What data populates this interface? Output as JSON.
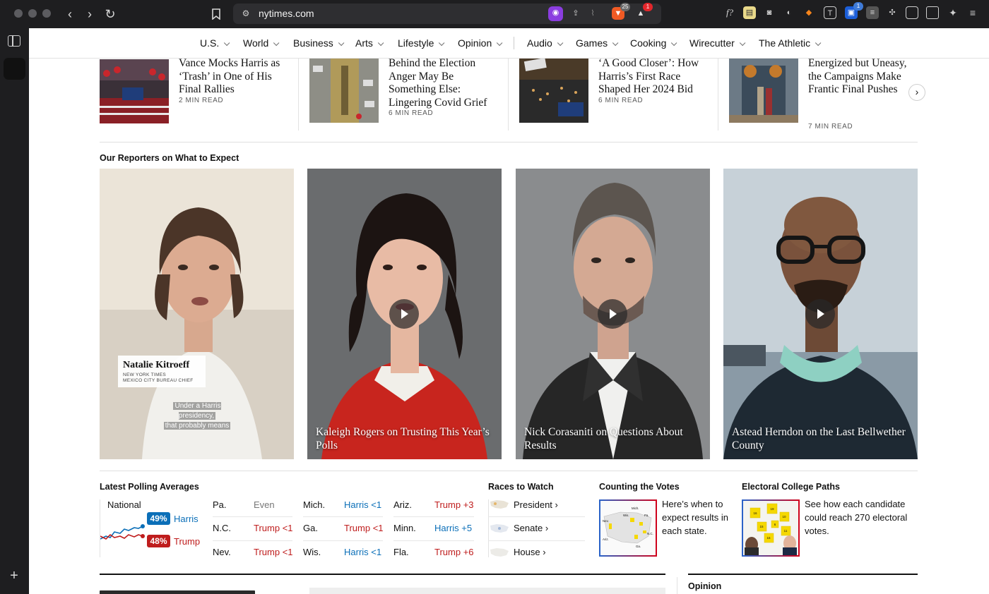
{
  "browser": {
    "url": "nytimes.com",
    "brave_badge": "25",
    "alert_badge": "1",
    "ext_badge": "1"
  },
  "nav": {
    "items": [
      "U.S.",
      "World",
      "Business",
      "Arts",
      "Lifestyle",
      "Opinion",
      "Audio",
      "Games",
      "Cooking",
      "Wirecutter",
      "The Athletic"
    ]
  },
  "stories": [
    {
      "title": "Vance Mocks Harris as ‘Trash’ in One of His Final Rallies",
      "read": "2 MIN READ"
    },
    {
      "title": "Behind the Election Anger May Be Something Else: Lingering Covid Grief",
      "read": "6 MIN READ"
    },
    {
      "title": "‘A Good Closer’: How Harris’s First Race Shaped Her 2024 Bid",
      "read": "6 MIN READ"
    },
    {
      "title": "Energized but Uneasy, the Campaigns Make Frantic Final Pushes",
      "read": "7 MIN READ"
    }
  ],
  "reporters": {
    "heading": "Our Reporters on What to Expect",
    "videos": [
      {
        "caption": "",
        "nametag_name": "Natalie Kitroeff",
        "nametag_org": "NEW YORK TIMES",
        "nametag_role": "MEXICO CITY BUREAU CHIEF",
        "subtitle_1": "Under a Harris presidency,",
        "subtitle_2": "that probably means"
      },
      {
        "caption": "Kaleigh Rogers on Trusting This Year’s Polls"
      },
      {
        "caption": "Nick Corasaniti on Questions About Results"
      },
      {
        "caption": "Astead Herndon on the Last Bellwether County"
      }
    ]
  },
  "polling": {
    "heading": "Latest Polling Averages",
    "national_label": "National",
    "harris_pct": "49%",
    "harris_label": "Harris",
    "trump_pct": "48%",
    "trump_label": "Trump",
    "states": [
      {
        "state": "Pa.",
        "lead": "Even",
        "party": "even"
      },
      {
        "state": "N.C.",
        "lead": "Trump <1",
        "party": "r"
      },
      {
        "state": "Nev.",
        "lead": "Trump <1",
        "party": "r"
      },
      {
        "state": "Mich.",
        "lead": "Harris <1",
        "party": "b"
      },
      {
        "state": "Ga.",
        "lead": "Trump <1",
        "party": "r"
      },
      {
        "state": "Wis.",
        "lead": "Harris <1",
        "party": "b"
      },
      {
        "state": "Ariz.",
        "lead": "Trump +3",
        "party": "r"
      },
      {
        "state": "Minn.",
        "lead": "Harris +5",
        "party": "b"
      },
      {
        "state": "Fla.",
        "lead": "Trump +6",
        "party": "r"
      }
    ],
    "colors": {
      "harris": "#0b6fb8",
      "trump": "#bf1d1d"
    }
  },
  "races": {
    "heading": "Races to Watch",
    "links": [
      "President ›",
      "Senate ›",
      "House ›"
    ]
  },
  "counting": {
    "heading": "Counting the Votes",
    "text": "Here’s when to expect results in each state.",
    "map_labels": [
      "Mich.",
      "Wis.",
      "Ariz.",
      "Nev.",
      "Ga.",
      "Pa.",
      "N.C."
    ]
  },
  "electoral": {
    "heading": "Electoral College Paths",
    "text": "See how each candidate could reach 270 electoral votes.",
    "square_labels": [
      "16",
      "19",
      "10",
      "15",
      "6",
      "11",
      "16"
    ]
  },
  "bottom": {
    "opinion_label": "Opinion"
  }
}
